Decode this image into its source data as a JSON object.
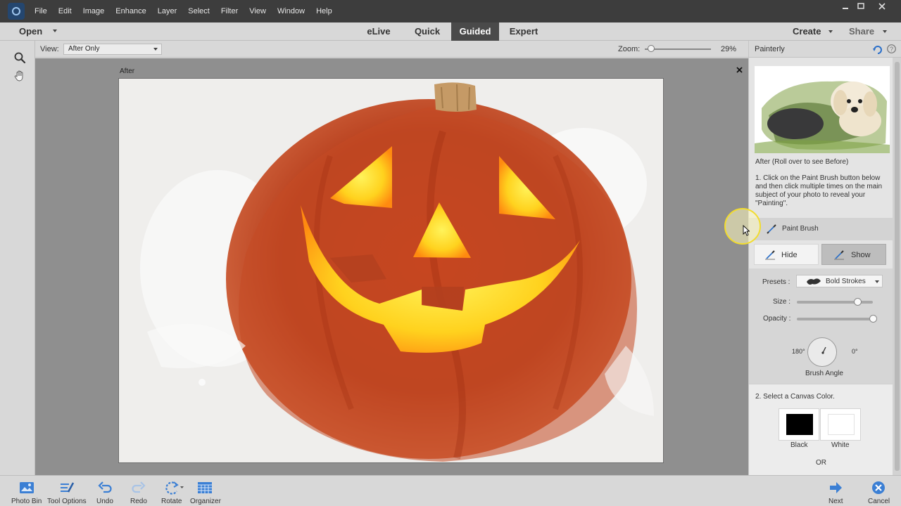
{
  "app": {
    "menu": [
      "File",
      "Edit",
      "Image",
      "Enhance",
      "Layer",
      "Select",
      "Filter",
      "View",
      "Window",
      "Help"
    ],
    "window_controls": [
      "minimize",
      "maximize",
      "close"
    ]
  },
  "modebar": {
    "open_label": "Open",
    "tabs": [
      {
        "label": "eLive",
        "active": false
      },
      {
        "label": "Quick",
        "active": false
      },
      {
        "label": "Guided",
        "active": true
      },
      {
        "label": "Expert",
        "active": false
      }
    ],
    "create_label": "Create",
    "share_label": "Share"
  },
  "options": {
    "view_label": "View:",
    "view_value": "After Only",
    "zoom_label": "Zoom:",
    "zoom_value": "29%",
    "zoom_level": 0.29
  },
  "document": {
    "label": "After",
    "close_icon": "close-icon"
  },
  "panel": {
    "title": "Painterly",
    "preview_caption": "After (Roll over to see Before)",
    "step1_lines": [
      "1. Click on the Paint Brush button below",
      "and then click multiple times on the main",
      "subject of your photo to reveal your",
      "\"Painting\"."
    ],
    "paint_brush_label": "Paint Brush",
    "hide_label": "Hide",
    "show_label": "Show",
    "presets_label": "Presets :",
    "presets_value": "Bold Strokes",
    "size_label": "Size :",
    "size_value": 0.8,
    "opacity_label": "Opacity :",
    "opacity_value": 1.0,
    "angle_left": "180°",
    "angle_right": "0°",
    "brush_angle_label": "Brush Angle",
    "step2": "2. Select a Canvas Color.",
    "black_label": "Black",
    "white_label": "White",
    "or_label": "OR",
    "colors": {
      "black": "#000000",
      "white": "#ffffff"
    }
  },
  "bottombar": {
    "items": [
      {
        "label": "Photo Bin",
        "icon": "photo-bin-icon"
      },
      {
        "label": "Tool Options",
        "icon": "tool-options-icon"
      },
      {
        "label": "Undo",
        "icon": "undo-icon"
      },
      {
        "label": "Redo",
        "icon": "redo-icon"
      },
      {
        "label": "Rotate",
        "icon": "rotate-icon"
      },
      {
        "label": "Organizer",
        "icon": "organizer-icon"
      },
      {
        "label": "Next",
        "icon": "next-icon"
      },
      {
        "label": "Cancel",
        "icon": "cancel-icon"
      }
    ]
  }
}
